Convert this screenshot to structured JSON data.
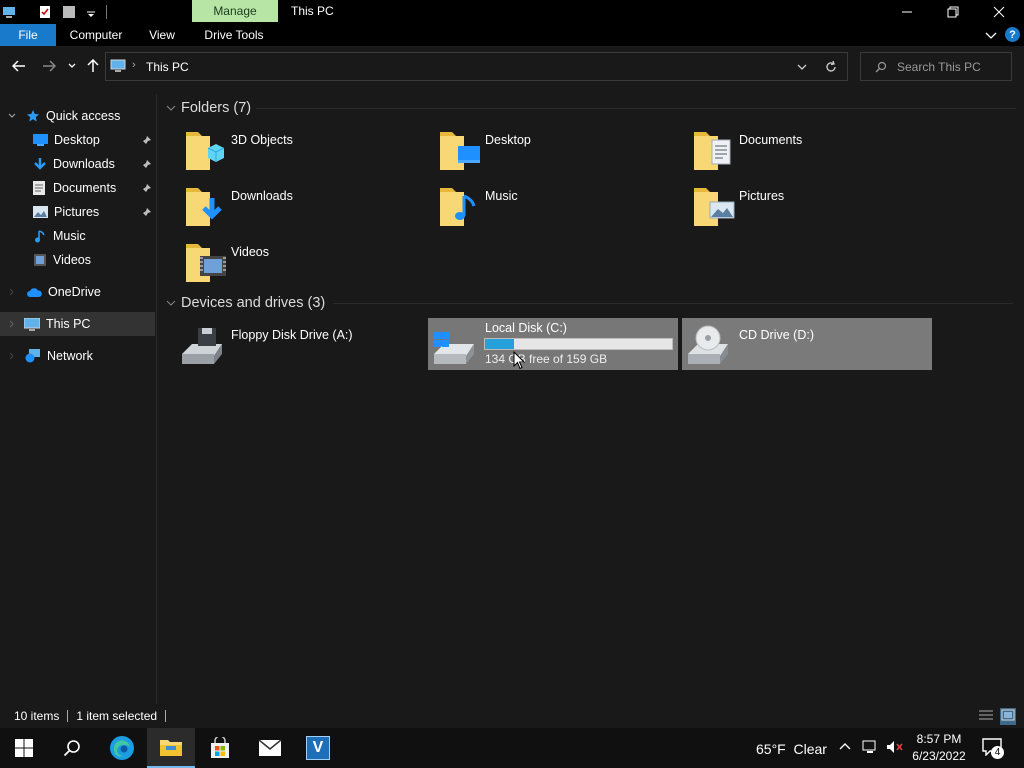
{
  "window": {
    "title": "This PC",
    "context_tab": "Manage"
  },
  "ribbon": {
    "tabs": [
      "File",
      "Computer",
      "View",
      "Drive Tools"
    ]
  },
  "address": {
    "path": "This PC",
    "search_placeholder": "Search This PC"
  },
  "sidebar": {
    "items": [
      {
        "label": "Quick access",
        "icon": "star-icon"
      },
      {
        "label": "Desktop",
        "icon": "desktop-icon",
        "pinned": true
      },
      {
        "label": "Downloads",
        "icon": "download-icon",
        "pinned": true
      },
      {
        "label": "Documents",
        "icon": "document-icon",
        "pinned": true
      },
      {
        "label": "Pictures",
        "icon": "pictures-icon",
        "pinned": true
      },
      {
        "label": "Music",
        "icon": "music-icon"
      },
      {
        "label": "Videos",
        "icon": "videos-icon"
      },
      {
        "label": "OneDrive",
        "icon": "cloud-icon"
      },
      {
        "label": "This PC",
        "icon": "computer-icon",
        "selected": true
      },
      {
        "label": "Network",
        "icon": "network-icon"
      }
    ]
  },
  "folders": {
    "header": "Folders (7)",
    "items": [
      "3D Objects",
      "Desktop",
      "Documents",
      "Downloads",
      "Music",
      "Pictures",
      "Videos"
    ]
  },
  "drives": {
    "header": "Devices and drives (3)",
    "items": [
      {
        "name": "Floppy Disk Drive (A:)"
      },
      {
        "name": "Local Disk (C:)",
        "space": "134 GB free of 159 GB",
        "used_fraction": 0.157
      },
      {
        "name": "CD Drive (D:)"
      }
    ]
  },
  "status": {
    "count": "10 items",
    "selected": "1 item selected"
  },
  "taskbar": {
    "weather": "65°F  Clear",
    "time": "8:57 PM",
    "date": "6/23/2022",
    "notifications": "4",
    "app_v_label": "V"
  },
  "colors": {
    "accent": "#1979ca",
    "manage_tab": "#b7e5a5",
    "folder": "#f8d775",
    "drive_bar": "#26a0da"
  }
}
